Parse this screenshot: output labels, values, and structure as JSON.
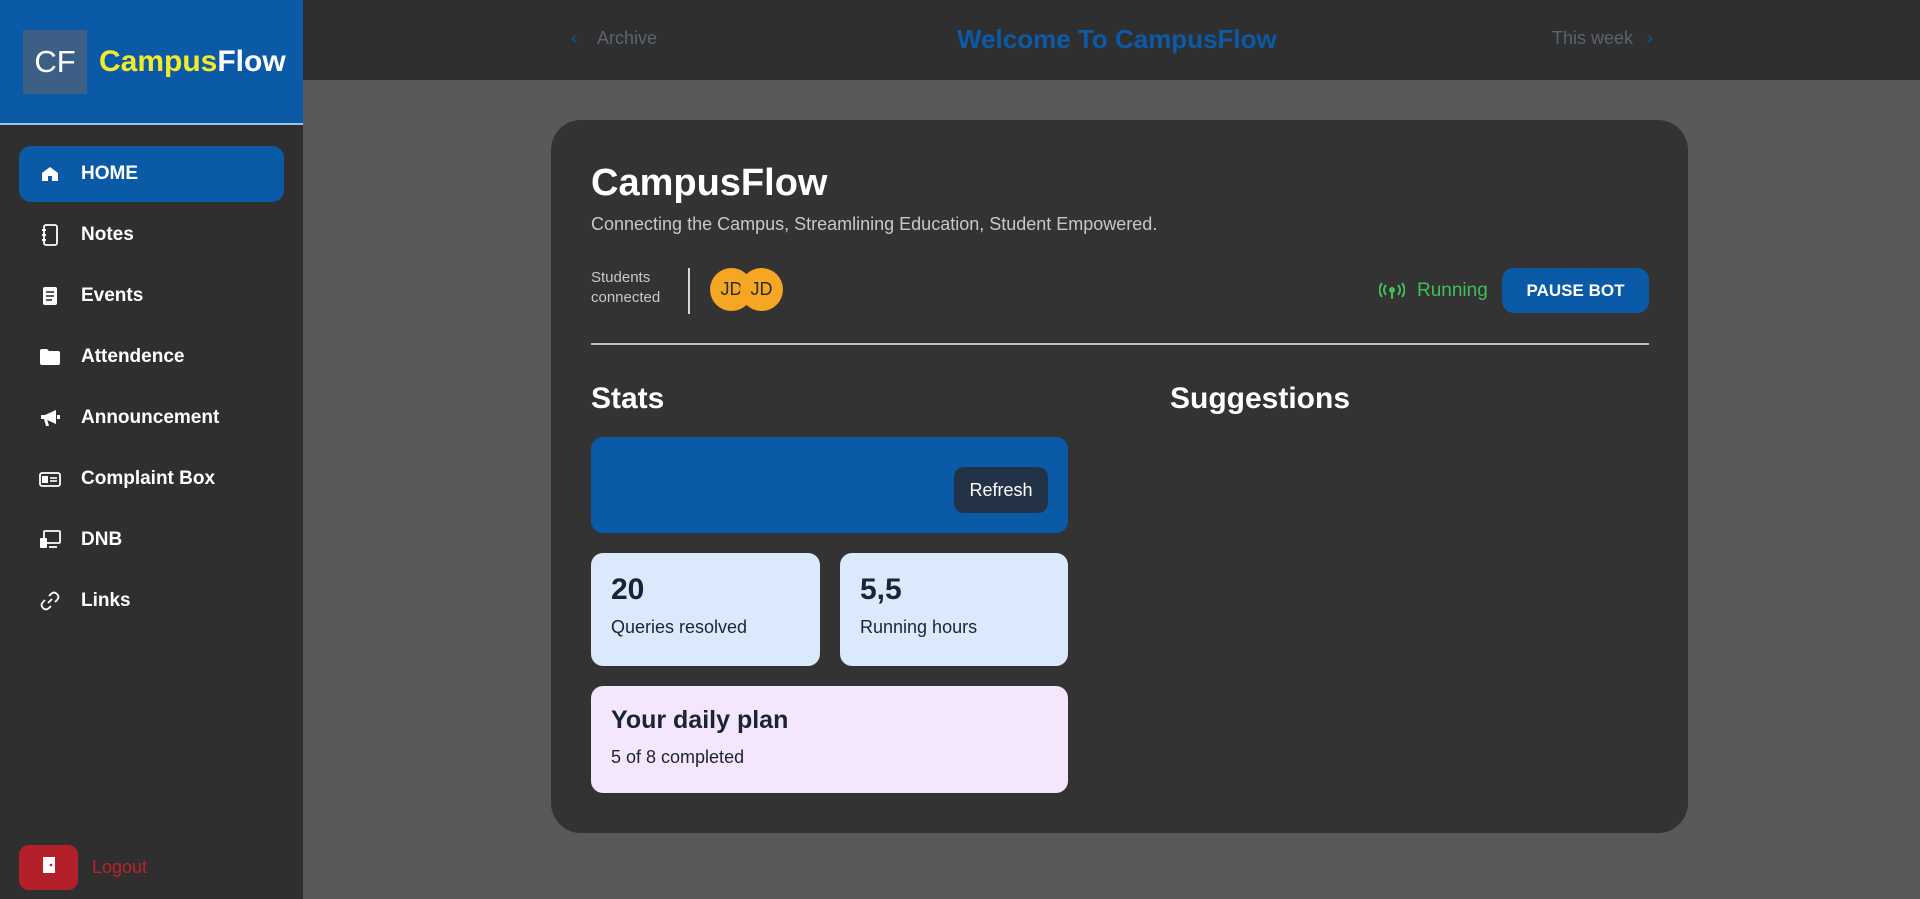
{
  "brand": {
    "logo": "CF",
    "name_part1": "Campus",
    "name_part2": "Flow"
  },
  "sidebar": {
    "items": [
      {
        "label": "HOME",
        "icon": "home-icon",
        "active": true
      },
      {
        "label": "Notes",
        "icon": "notebook-icon",
        "active": false
      },
      {
        "label": "Events",
        "icon": "document-icon",
        "active": false
      },
      {
        "label": "Attendence",
        "icon": "folder-icon",
        "active": false
      },
      {
        "label": "Announcement",
        "icon": "megaphone-icon",
        "active": false
      },
      {
        "label": "Complaint Box",
        "icon": "inbox-icon",
        "active": false
      },
      {
        "label": "DNB",
        "icon": "monitor-icon",
        "active": false
      },
      {
        "label": "Links",
        "icon": "link-icon",
        "active": false
      }
    ],
    "logout_label": "Logout"
  },
  "topbar": {
    "prev_label": "Archive",
    "title": "Welcome To CampusFlow",
    "next_label": "This week"
  },
  "main": {
    "title": "CampusFlow",
    "subtitle": "Connecting the Campus, Streamlining Education, Student Empowered.",
    "students_line1": "Students",
    "students_line2": "connected",
    "avatars": [
      "JD",
      "JD"
    ],
    "status_text": "Running",
    "pause_label": "PAUSE BOT",
    "stats_heading": "Stats",
    "suggestions_heading": "Suggestions",
    "refresh_label": "Refresh",
    "stats": [
      {
        "value": "20",
        "label": "Queries resolved"
      },
      {
        "value": "5,5",
        "label": "Running hours"
      }
    ],
    "plan": {
      "title": "Your daily plan",
      "subtitle": "5 of 8 completed"
    }
  },
  "colors": {
    "accent": "#0b5aa8",
    "brand_yellow": "#f4ea2a",
    "running_green": "#3fbf55",
    "logout_red": "#b3202a",
    "avatar_orange": "#f5a623",
    "stat_card_bg": "#dbe9fc",
    "plan_card_bg": "#f4e6fc"
  }
}
